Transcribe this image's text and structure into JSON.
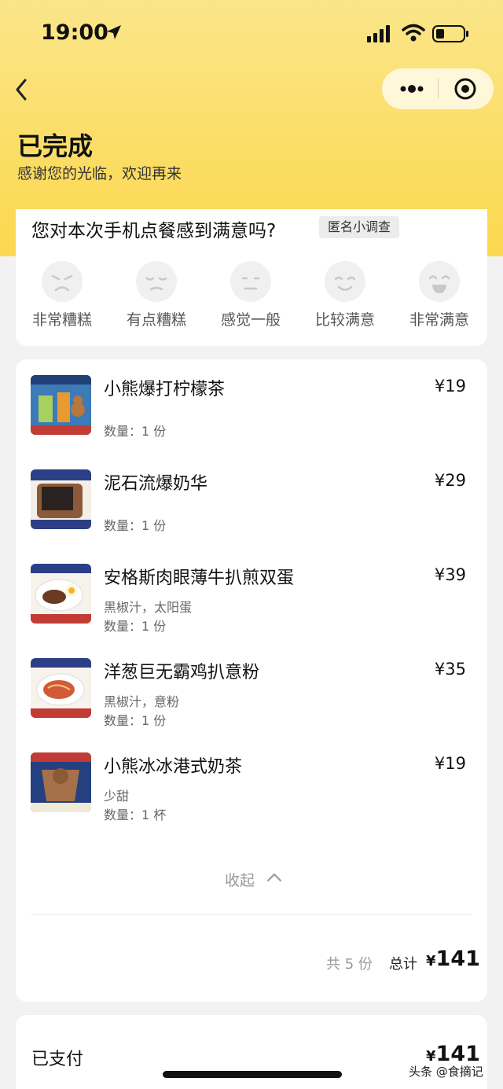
{
  "status_bar": {
    "time": "19:00"
  },
  "header": {
    "title": "已完成",
    "subtitle": "感谢您的光临，欢迎再来"
  },
  "survey": {
    "question": "您对本次手机点餐感到满意吗?",
    "badge": "匿名小调查",
    "options": [
      {
        "label": "非常糟糕",
        "icon": "very-bad-face-icon"
      },
      {
        "label": "有点糟糕",
        "icon": "bad-face-icon"
      },
      {
        "label": "感觉一般",
        "icon": "neutral-face-icon"
      },
      {
        "label": "比较满意",
        "icon": "good-face-icon"
      },
      {
        "label": "非常满意",
        "icon": "very-good-face-icon"
      }
    ]
  },
  "order": {
    "items": [
      {
        "name": "小熊爆打柠檬茶",
        "price": "¥19",
        "spec": "",
        "qty": "数量：1 份"
      },
      {
        "name": "泥石流爆奶华",
        "price": "¥29",
        "spec": "",
        "qty": "数量：1 份"
      },
      {
        "name": "安格斯肉眼薄牛扒煎双蛋",
        "price": "¥39",
        "spec": "黑椒汁，太阳蛋",
        "qty": "数量：1 份"
      },
      {
        "name": "洋葱巨无霸鸡扒意粉",
        "price": "¥35",
        "spec": "黑椒汁，意粉",
        "qty": "数量：1 份"
      },
      {
        "name": "小熊冰冰港式奶茶",
        "price": "¥19",
        "spec": "少甜",
        "qty": "数量：1 杯"
      }
    ],
    "collapse_label": "收起",
    "count_text": "共 5 份",
    "total_label": "总计",
    "total_symbol": "¥",
    "total_value": "141"
  },
  "payment": {
    "label": "已支付",
    "symbol": "¥",
    "value": "141"
  },
  "watermark": "头条 @食摘记",
  "colors": {
    "header_yellow": "#fbd84e",
    "background": "#f2f2f2",
    "card": "#ffffff"
  }
}
